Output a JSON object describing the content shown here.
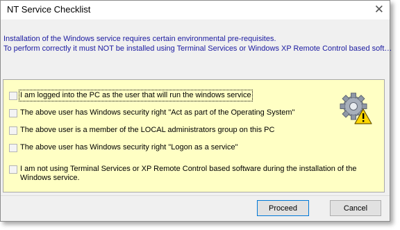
{
  "window": {
    "title": "NT Service Checklist",
    "close_glyph": "✕"
  },
  "intro": {
    "line1": "Installation of the Windows service requires certain environmental pre-requisites.",
    "line2": "To perform correctly it must NOT be installed using Terminal Services or Windows XP Remote Control based soft…"
  },
  "checklist": {
    "items": [
      {
        "label": "I am logged into the PC as the user that will run the windows service",
        "checked": false
      },
      {
        "label": "The above user has Windows security right \"Act as part of the Operating System\"",
        "checked": false
      },
      {
        "label": "The above user is a member of the LOCAL administrators group on this PC",
        "checked": false
      },
      {
        "label": "The above user has Windows security right \"Logon as a service\"",
        "checked": false
      },
      {
        "label": "I am not using Terminal Services or XP Remote Control based software during the installation of the Windows service.",
        "checked": false
      }
    ],
    "icon": "gear-warning-icon"
  },
  "buttons": {
    "proceed": "Proceed",
    "cancel": "Cancel"
  },
  "colors": {
    "panel_background": "#ffffc4",
    "intro_text": "#1a1aa0",
    "window_background": "#f0f0f0"
  }
}
